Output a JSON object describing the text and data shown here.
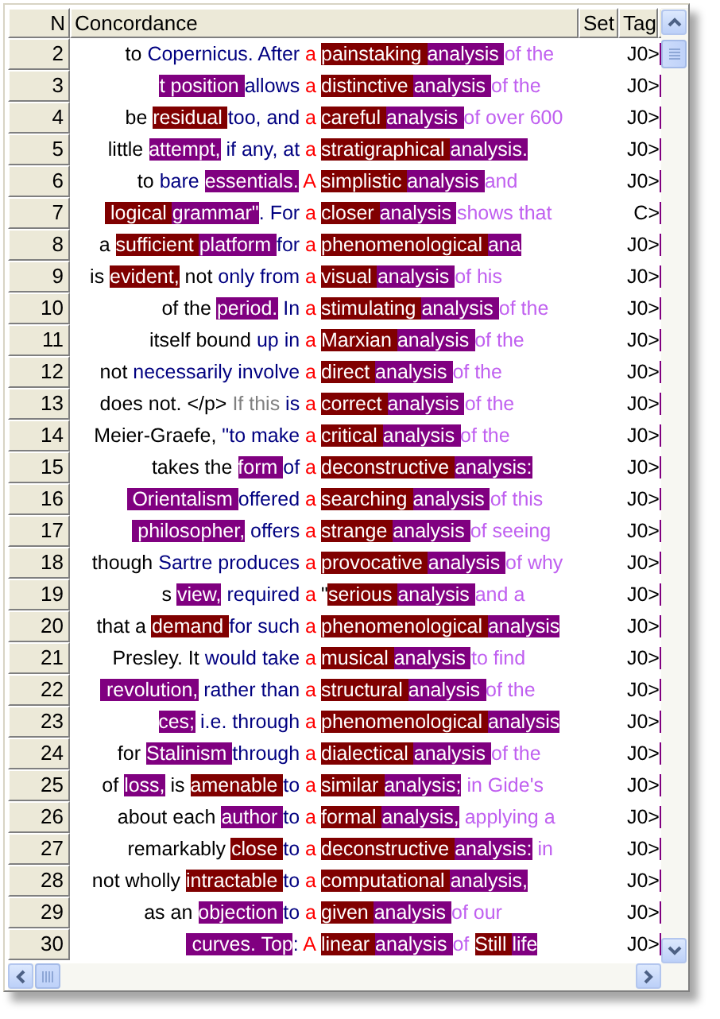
{
  "columns": [
    {
      "label": "N"
    },
    {
      "label": "Concordance"
    },
    {
      "label": "Set"
    },
    {
      "label": "Tag"
    }
  ],
  "rows": [
    {
      "n": "2",
      "tag": "J0>",
      "left": [
        {
          "kind": "plain",
          "text": "to "
        },
        {
          "kind": "blue",
          "text": "Copernicus. After "
        },
        {
          "kind": "node",
          "text": "a"
        }
      ],
      "right": [
        {
          "kind": "maroon",
          "text": "painstaking "
        },
        {
          "kind": "purple",
          "text": "analysis "
        },
        {
          "kind": "light",
          "text": "of the"
        }
      ]
    },
    {
      "n": "3",
      "tag": "J0>",
      "left": [
        {
          "kind": "purple",
          "text": "t position "
        },
        {
          "kind": "blue",
          "text": "allows "
        },
        {
          "kind": "node",
          "text": "a"
        }
      ],
      "right": [
        {
          "kind": "maroon",
          "text": "distinctive "
        },
        {
          "kind": "purple",
          "text": "analysis "
        },
        {
          "kind": "light",
          "text": "of the"
        }
      ]
    },
    {
      "n": "4",
      "tag": "J0>",
      "left": [
        {
          "kind": "plain",
          "text": "be "
        },
        {
          "kind": "maroon",
          "text": "residual "
        },
        {
          "kind": "blue",
          "text": "too, and "
        },
        {
          "kind": "node",
          "text": "a"
        }
      ],
      "right": [
        {
          "kind": "maroon",
          "text": "careful "
        },
        {
          "kind": "purple",
          "text": "analysis "
        },
        {
          "kind": "light",
          "text": "of over 600"
        }
      ]
    },
    {
      "n": "5",
      "tag": "J0>",
      "left": [
        {
          "kind": "plain",
          "text": "little "
        },
        {
          "kind": "purple",
          "text": "attempt,"
        },
        {
          "kind": "blue",
          "text": " if any, at "
        },
        {
          "kind": "node",
          "text": "a"
        }
      ],
      "right": [
        {
          "kind": "maroon",
          "text": "stratigraphical "
        },
        {
          "kind": "purple",
          "text": "analysis."
        }
      ]
    },
    {
      "n": "6",
      "tag": "J0>",
      "left": [
        {
          "kind": "plain",
          "text": "to "
        },
        {
          "kind": "blue",
          "text": "bare "
        },
        {
          "kind": "purple",
          "text": "essentials."
        },
        {
          "kind": "node",
          "text": " A"
        }
      ],
      "right": [
        {
          "kind": "maroon",
          "text": "simplistic "
        },
        {
          "kind": "purple",
          "text": "analysis "
        },
        {
          "kind": "light",
          "text": "and"
        }
      ]
    },
    {
      "n": "7",
      "tag": "C>",
      "left": [
        {
          "kind": "maroon",
          "text": " logical "
        },
        {
          "kind": "purple",
          "text": "grammar\""
        },
        {
          "kind": "blue",
          "text": ". For "
        },
        {
          "kind": "node",
          "text": "a"
        }
      ],
      "right": [
        {
          "kind": "maroon",
          "text": "closer "
        },
        {
          "kind": "purple",
          "text": "analysis "
        },
        {
          "kind": "light",
          "text": "shows that"
        }
      ]
    },
    {
      "n": "8",
      "tag": "J0>",
      "left": [
        {
          "kind": "plain",
          "text": "a "
        },
        {
          "kind": "maroon",
          "text": "sufficient "
        },
        {
          "kind": "purple",
          "text": "platform "
        },
        {
          "kind": "blue",
          "text": "for "
        },
        {
          "kind": "node",
          "text": "a"
        }
      ],
      "right": [
        {
          "kind": "maroon",
          "text": "phenomenological "
        },
        {
          "kind": "purple",
          "text": "ana"
        }
      ]
    },
    {
      "n": "9",
      "tag": "J0>",
      "left": [
        {
          "kind": "plain",
          "text": "is "
        },
        {
          "kind": "maroon",
          "text": "evident,"
        },
        {
          "kind": "plain",
          "text": " not "
        },
        {
          "kind": "blue",
          "text": "only from "
        },
        {
          "kind": "node",
          "text": "a"
        }
      ],
      "right": [
        {
          "kind": "maroon",
          "text": "visual "
        },
        {
          "kind": "purple",
          "text": "analysis "
        },
        {
          "kind": "light",
          "text": "of his"
        }
      ]
    },
    {
      "n": "10",
      "tag": "J0>",
      "left": [
        {
          "kind": "plain",
          "text": "of the "
        },
        {
          "kind": "purple",
          "text": "period."
        },
        {
          "kind": "blue",
          "text": " In "
        },
        {
          "kind": "node",
          "text": "a"
        }
      ],
      "right": [
        {
          "kind": "maroon",
          "text": "stimulating "
        },
        {
          "kind": "purple",
          "text": "analysis "
        },
        {
          "kind": "light",
          "text": "of the"
        }
      ]
    },
    {
      "n": "11",
      "tag": "J0>",
      "left": [
        {
          "kind": "plain",
          "text": "itself bound "
        },
        {
          "kind": "blue",
          "text": "up in "
        },
        {
          "kind": "node",
          "text": "a"
        }
      ],
      "right": [
        {
          "kind": "maroon",
          "text": "Marxian "
        },
        {
          "kind": "purple",
          "text": "analysis "
        },
        {
          "kind": "light",
          "text": "of the"
        }
      ]
    },
    {
      "n": "12",
      "tag": "J0>",
      "left": [
        {
          "kind": "plain",
          "text": "not "
        },
        {
          "kind": "blue",
          "text": "necessarily involve "
        },
        {
          "kind": "node",
          "text": "a"
        }
      ],
      "right": [
        {
          "kind": "maroon",
          "text": "direct "
        },
        {
          "kind": "purple",
          "text": "analysis "
        },
        {
          "kind": "light",
          "text": "of the"
        }
      ]
    },
    {
      "n": "13",
      "tag": "J0>",
      "left": [
        {
          "kind": "plain",
          "text": "does not. </p> "
        },
        {
          "kind": "grey",
          "text": "If this "
        },
        {
          "kind": "blue",
          "text": "is "
        },
        {
          "kind": "node",
          "text": "a"
        }
      ],
      "right": [
        {
          "kind": "maroon",
          "text": "correct "
        },
        {
          "kind": "purple",
          "text": "analysis "
        },
        {
          "kind": "light",
          "text": "of the"
        }
      ]
    },
    {
      "n": "14",
      "tag": "J0>",
      "left": [
        {
          "kind": "plain",
          "text": "Meier-Graefe, "
        },
        {
          "kind": "blue",
          "text": "\"to make "
        },
        {
          "kind": "node",
          "text": "a"
        }
      ],
      "right": [
        {
          "kind": "maroon",
          "text": "critical "
        },
        {
          "kind": "purple",
          "text": "analysis "
        },
        {
          "kind": "light",
          "text": "of the"
        }
      ]
    },
    {
      "n": "15",
      "tag": "J0>",
      "left": [
        {
          "kind": "plain",
          "text": "takes the "
        },
        {
          "kind": "purple",
          "text": "form "
        },
        {
          "kind": "blue",
          "text": "of "
        },
        {
          "kind": "node",
          "text": "a"
        }
      ],
      "right": [
        {
          "kind": "maroon",
          "text": "deconstructive "
        },
        {
          "kind": "purple",
          "text": "analysis:"
        }
      ]
    },
    {
      "n": "16",
      "tag": "J0>",
      "left": [
        {
          "kind": "purple",
          "text": " Orientalism "
        },
        {
          "kind": "blue",
          "text": "offered "
        },
        {
          "kind": "node",
          "text": "a"
        }
      ],
      "right": [
        {
          "kind": "maroon",
          "text": "searching "
        },
        {
          "kind": "purple",
          "text": "analysis "
        },
        {
          "kind": "light",
          "text": "of this"
        }
      ]
    },
    {
      "n": "17",
      "tag": "J0>",
      "left": [
        {
          "kind": "purple",
          "text": " philosopher,"
        },
        {
          "kind": "blue",
          "text": " offers "
        },
        {
          "kind": "node",
          "text": "a"
        }
      ],
      "right": [
        {
          "kind": "maroon",
          "text": "strange "
        },
        {
          "kind": "purple",
          "text": "analysis "
        },
        {
          "kind": "light",
          "text": "of seeing"
        }
      ]
    },
    {
      "n": "18",
      "tag": "J0>",
      "left": [
        {
          "kind": "plain",
          "text": "though "
        },
        {
          "kind": "blue",
          "text": "Sartre produces "
        },
        {
          "kind": "node",
          "text": "a"
        }
      ],
      "right": [
        {
          "kind": "maroon",
          "text": "provocative "
        },
        {
          "kind": "purple",
          "text": "analysis "
        },
        {
          "kind": "light",
          "text": "of why"
        }
      ]
    },
    {
      "n": "19",
      "tag": "J0>",
      "left": [
        {
          "kind": "plain",
          "text": "s "
        },
        {
          "kind": "purple",
          "text": "view,"
        },
        {
          "kind": "blue",
          "text": " required "
        },
        {
          "kind": "node",
          "text": "a"
        }
      ],
      "right": [
        {
          "kind": "plain",
          "text": "\""
        },
        {
          "kind": "maroon",
          "text": "serious "
        },
        {
          "kind": "purple",
          "text": "analysis "
        },
        {
          "kind": "light",
          "text": "and a"
        }
      ]
    },
    {
      "n": "20",
      "tag": "J0>",
      "left": [
        {
          "kind": "plain",
          "text": "that a "
        },
        {
          "kind": "maroon",
          "text": "demand "
        },
        {
          "kind": "blue",
          "text": "for such "
        },
        {
          "kind": "node",
          "text": "a"
        }
      ],
      "right": [
        {
          "kind": "maroon",
          "text": "phenomenological "
        },
        {
          "kind": "purple",
          "text": "analysis"
        }
      ]
    },
    {
      "n": "21",
      "tag": "J0>",
      "left": [
        {
          "kind": "plain",
          "text": "Presley. It "
        },
        {
          "kind": "blue",
          "text": "would take "
        },
        {
          "kind": "node",
          "text": "a"
        }
      ],
      "right": [
        {
          "kind": "maroon",
          "text": "musical "
        },
        {
          "kind": "purple",
          "text": "analysis "
        },
        {
          "kind": "light",
          "text": "to find"
        }
      ]
    },
    {
      "n": "22",
      "tag": "J0>",
      "left": [
        {
          "kind": "purple",
          "text": " revolution,"
        },
        {
          "kind": "blue",
          "text": " rather than "
        },
        {
          "kind": "node",
          "text": "a"
        }
      ],
      "right": [
        {
          "kind": "maroon",
          "text": "structural "
        },
        {
          "kind": "purple",
          "text": "analysis "
        },
        {
          "kind": "light",
          "text": "of the"
        }
      ]
    },
    {
      "n": "23",
      "tag": "J0>",
      "left": [
        {
          "kind": "purple",
          "text": "ces;"
        },
        {
          "kind": "blue",
          "text": " i.e. through "
        },
        {
          "kind": "node",
          "text": "a"
        }
      ],
      "right": [
        {
          "kind": "maroon",
          "text": "phenomenological "
        },
        {
          "kind": "purple",
          "text": "analysis"
        }
      ]
    },
    {
      "n": "24",
      "tag": "J0>",
      "left": [
        {
          "kind": "plain",
          "text": "for "
        },
        {
          "kind": "purple",
          "text": "Stalinism "
        },
        {
          "kind": "blue",
          "text": "through "
        },
        {
          "kind": "node",
          "text": "a"
        }
      ],
      "right": [
        {
          "kind": "maroon",
          "text": "dialectical "
        },
        {
          "kind": "purple",
          "text": "analysis "
        },
        {
          "kind": "light",
          "text": "of the"
        }
      ]
    },
    {
      "n": "25",
      "tag": "J0>",
      "left": [
        {
          "kind": "plain",
          "text": "of "
        },
        {
          "kind": "purple",
          "text": "loss,"
        },
        {
          "kind": "plain",
          "text": " is "
        },
        {
          "kind": "maroon",
          "text": "amenable "
        },
        {
          "kind": "blue",
          "text": "to "
        },
        {
          "kind": "node",
          "text": "a"
        }
      ],
      "right": [
        {
          "kind": "maroon",
          "text": "similar "
        },
        {
          "kind": "purple",
          "text": "analysis;"
        },
        {
          "kind": "light",
          "text": " in Gide's"
        }
      ]
    },
    {
      "n": "26",
      "tag": "J0>",
      "left": [
        {
          "kind": "plain",
          "text": "about each "
        },
        {
          "kind": "purple",
          "text": "author "
        },
        {
          "kind": "blue",
          "text": "to "
        },
        {
          "kind": "node",
          "text": "a"
        }
      ],
      "right": [
        {
          "kind": "maroon",
          "text": "formal "
        },
        {
          "kind": "purple",
          "text": "analysis,"
        },
        {
          "kind": "light",
          "text": " applying a"
        }
      ]
    },
    {
      "n": "27",
      "tag": "J0>",
      "left": [
        {
          "kind": "plain",
          "text": "remarkably "
        },
        {
          "kind": "maroon",
          "text": "close "
        },
        {
          "kind": "blue",
          "text": "to "
        },
        {
          "kind": "node",
          "text": "a"
        }
      ],
      "right": [
        {
          "kind": "maroon",
          "text": "deconstructive "
        },
        {
          "kind": "purple",
          "text": "analysis:"
        },
        {
          "kind": "light",
          "text": " in"
        }
      ]
    },
    {
      "n": "28",
      "tag": "J0>",
      "left": [
        {
          "kind": "plain",
          "text": "not wholly "
        },
        {
          "kind": "maroon",
          "text": "intractable "
        },
        {
          "kind": "blue",
          "text": "to "
        },
        {
          "kind": "node",
          "text": "a"
        }
      ],
      "right": [
        {
          "kind": "maroon",
          "text": "computational "
        },
        {
          "kind": "purple",
          "text": "analysis,"
        }
      ]
    },
    {
      "n": "29",
      "tag": "J0>",
      "left": [
        {
          "kind": "plain",
          "text": "as an "
        },
        {
          "kind": "purple",
          "text": "objection "
        },
        {
          "kind": "blue",
          "text": "to "
        },
        {
          "kind": "node",
          "text": "a"
        }
      ],
      "right": [
        {
          "kind": "maroon",
          "text": "given "
        },
        {
          "kind": "purple",
          "text": "analysis "
        },
        {
          "kind": "light",
          "text": "of our"
        }
      ]
    },
    {
      "n": "30",
      "tag": "J0>",
      "left": [
        {
          "kind": "purple",
          "text": " curves. Top"
        },
        {
          "kind": "blue",
          "text": ": "
        },
        {
          "kind": "node",
          "text": "A"
        }
      ],
      "right": [
        {
          "kind": "maroon",
          "text": "linear "
        },
        {
          "kind": "purple",
          "text": "analysis "
        },
        {
          "kind": "light",
          "text": "of "
        },
        {
          "kind": "maroon",
          "text": "Still "
        },
        {
          "kind": "purple",
          "text": "life"
        }
      ]
    }
  ]
}
